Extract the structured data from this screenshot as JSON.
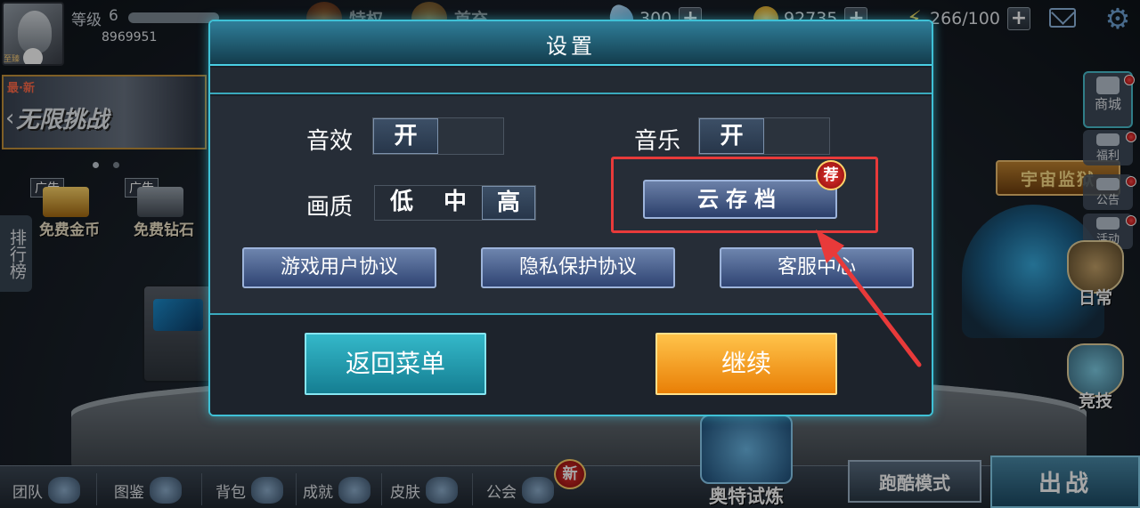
{
  "player": {
    "level_label": "等级",
    "level": "6",
    "uid": "8969951",
    "rank_tag": "至臻"
  },
  "top_tabs": [
    {
      "label": "特权"
    },
    {
      "label": "首充"
    }
  ],
  "resources": {
    "gems": "300",
    "gold": "92735",
    "energy": "266/100"
  },
  "left": {
    "banner_tag": "最·新",
    "banner_title": "无限挑战",
    "ad_badge": "广告",
    "free_gold": "免费金币",
    "free_diamond": "免费钻石",
    "rank_tab": "排行榜"
  },
  "right": {
    "shop": "商城",
    "gift": "福利",
    "notice": "公告",
    "event": "活动",
    "daily": "日常",
    "arena": "竞技",
    "sign": "宇宙监狱"
  },
  "bottom": {
    "items": [
      {
        "label": "团队"
      },
      {
        "label": "图鉴"
      },
      {
        "label": "背包"
      },
      {
        "label": "成就"
      },
      {
        "label": "皮肤"
      },
      {
        "label": "公会"
      }
    ],
    "new_badge": "新",
    "trial": "奥特试炼",
    "parkour": "跑酷模式",
    "battle": "出战"
  },
  "settings": {
    "title": "设置",
    "sound_label": "音效",
    "sound_value": "开",
    "music_label": "音乐",
    "music_value": "开",
    "quality_label": "画质",
    "quality_options": [
      "低",
      "中",
      "高"
    ],
    "quality_selected": "高",
    "cloud_save": "云存档",
    "recommend_badge": "荐",
    "user_agreement": "游戏用户协议",
    "privacy": "隐私保护协议",
    "support": "客服中心",
    "back_to_menu": "返回菜单",
    "continue": "继续"
  },
  "colors": {
    "dialog_border": "#3fc1d6",
    "highlight": "#e83a3a",
    "continue_button": "#f29a1b",
    "menu_button": "#2aa6b8"
  }
}
